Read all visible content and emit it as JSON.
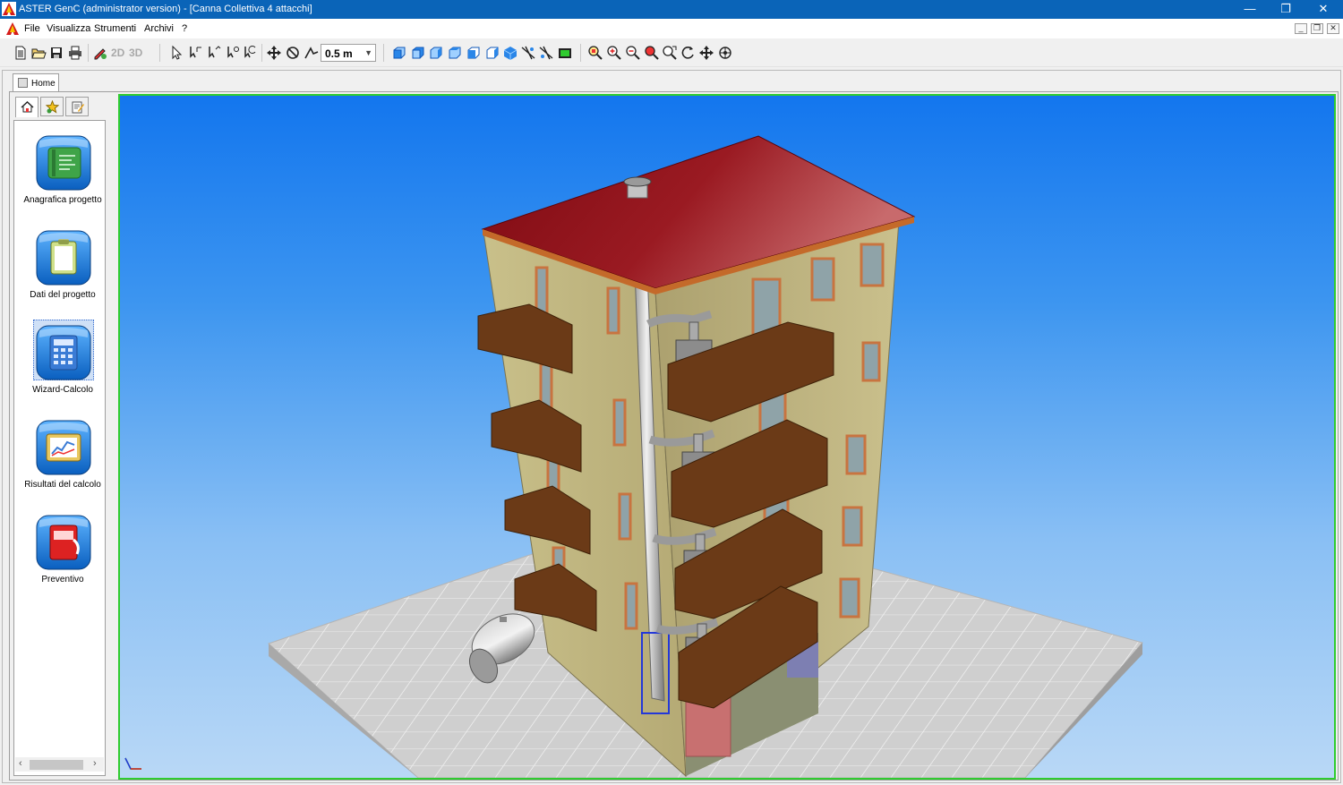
{
  "titlebar": {
    "title": "ASTER GenC (administrator version) - [Canna Collettiva 4 attacchi]",
    "minimize": "—",
    "restore": "❐",
    "close": "✕"
  },
  "menu": {
    "items": [
      "File",
      "Visualizza",
      "Strumenti",
      "Archivi",
      "?"
    ],
    "mdi_minimize": "_",
    "mdi_restore": "❐",
    "mdi_close": "✕"
  },
  "toolbar": {
    "view_2d": "2D",
    "view_3d": "3D",
    "step_value": "0.5  m",
    "icons": [
      "new-file-icon",
      "open-folder-icon",
      "save-icon",
      "print-icon",
      "edit-3d-icon",
      "select-arrow-icon",
      "select-node-icon",
      "select-node-alt-icon",
      "select-multi-icon",
      "select-area-icon",
      "move-icon",
      "rotate-icon",
      "measure-icon",
      "view-front-icon",
      "view-back-icon",
      "view-left-icon",
      "view-right-icon",
      "view-top-icon",
      "view-bottom-icon",
      "view-iso-icon",
      "wireframe-icon",
      "wireframe-alt-icon",
      "background-icon",
      "zoom-fit-icon",
      "zoom-in-icon",
      "zoom-out-icon",
      "zoom-all-icon",
      "zoom-window-icon",
      "orbit-icon",
      "pan-icon",
      "rotate-3d-icon"
    ]
  },
  "document": {
    "tab_label": "Home"
  },
  "left_panel": {
    "tabs": [
      "home-tab-icon",
      "favorites-tab-icon",
      "notes-tab-icon"
    ],
    "items": [
      {
        "label": "Anagrafica progetto",
        "icon": "project-registry-icon",
        "color": "#3fa448"
      },
      {
        "label": "Dati del progetto",
        "icon": "clipboard-icon",
        "color": "#cfe08a"
      },
      {
        "label": "Wizard-Calcolo",
        "icon": "calculator-icon",
        "color": "#3a7bd5"
      },
      {
        "label": "Risultati del calcolo",
        "icon": "chart-results-icon",
        "color": "#e8c860"
      },
      {
        "label": "Preventivo",
        "icon": "quote-document-icon",
        "color": "#d22"
      }
    ]
  },
  "viewport": {
    "accent": "#2fcc2f",
    "roof_color": "#8e1018",
    "wall_color": "#bfb583",
    "balcony_color": "#6b3a17"
  }
}
